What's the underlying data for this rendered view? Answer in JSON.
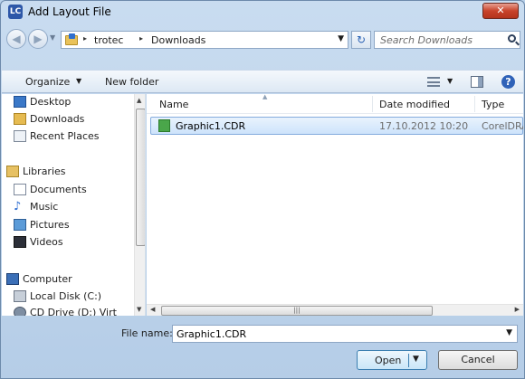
{
  "window": {
    "title": "Add Layout File",
    "app_icon_text": "LC",
    "close_glyph": "✕"
  },
  "address": {
    "back_glyph": "◀",
    "forward_glyph": "▶",
    "separator": "▸",
    "path": [
      "trotec",
      "Downloads"
    ],
    "dropdown_glyph": "▼",
    "refresh_glyph": "↻"
  },
  "search": {
    "placeholder": "Search Downloads"
  },
  "toolbar": {
    "organize_label": "Organize",
    "dropdown_glyph": "▼",
    "new_folder_label": "New folder",
    "help_glyph": "?"
  },
  "sidebar": {
    "items": [
      {
        "label": "Desktop",
        "icon": "desktop-icon"
      },
      {
        "label": "Downloads",
        "icon": "downloads-folder-icon"
      },
      {
        "label": "Recent Places",
        "icon": "recent-places-icon"
      },
      {
        "label": "Libraries",
        "icon": "libraries-icon"
      },
      {
        "label": "Documents",
        "icon": "documents-icon"
      },
      {
        "label": "Music",
        "icon": "music-icon"
      },
      {
        "label": "Pictures",
        "icon": "pictures-icon"
      },
      {
        "label": "Videos",
        "icon": "videos-icon"
      },
      {
        "label": "Computer",
        "icon": "computer-icon"
      },
      {
        "label": "Local Disk (C:)",
        "icon": "local-disk-icon"
      },
      {
        "label": "CD Drive (D:) Virt",
        "icon": "cd-drive-icon"
      }
    ],
    "scroll_up_glyph": "▲",
    "scroll_down_glyph": "▼"
  },
  "file_list": {
    "columns": [
      "Name",
      "Date modified",
      "Type"
    ],
    "sort_glyph": "▲",
    "rows": [
      {
        "name": "Graphic1.CDR",
        "date_modified": "17.10.2012 10:20",
        "type": "CorelDRAW"
      }
    ],
    "hscroll_grip": "|||",
    "hscroll_left_glyph": "◀",
    "hscroll_right_glyph": "▶"
  },
  "footer": {
    "file_name_label": "File name:",
    "file_name_value": "Graphic1.CDR",
    "dropdown_glyph": "▼",
    "open_label": "Open",
    "open_arrow_glyph": "▼",
    "cancel_label": "Cancel"
  }
}
